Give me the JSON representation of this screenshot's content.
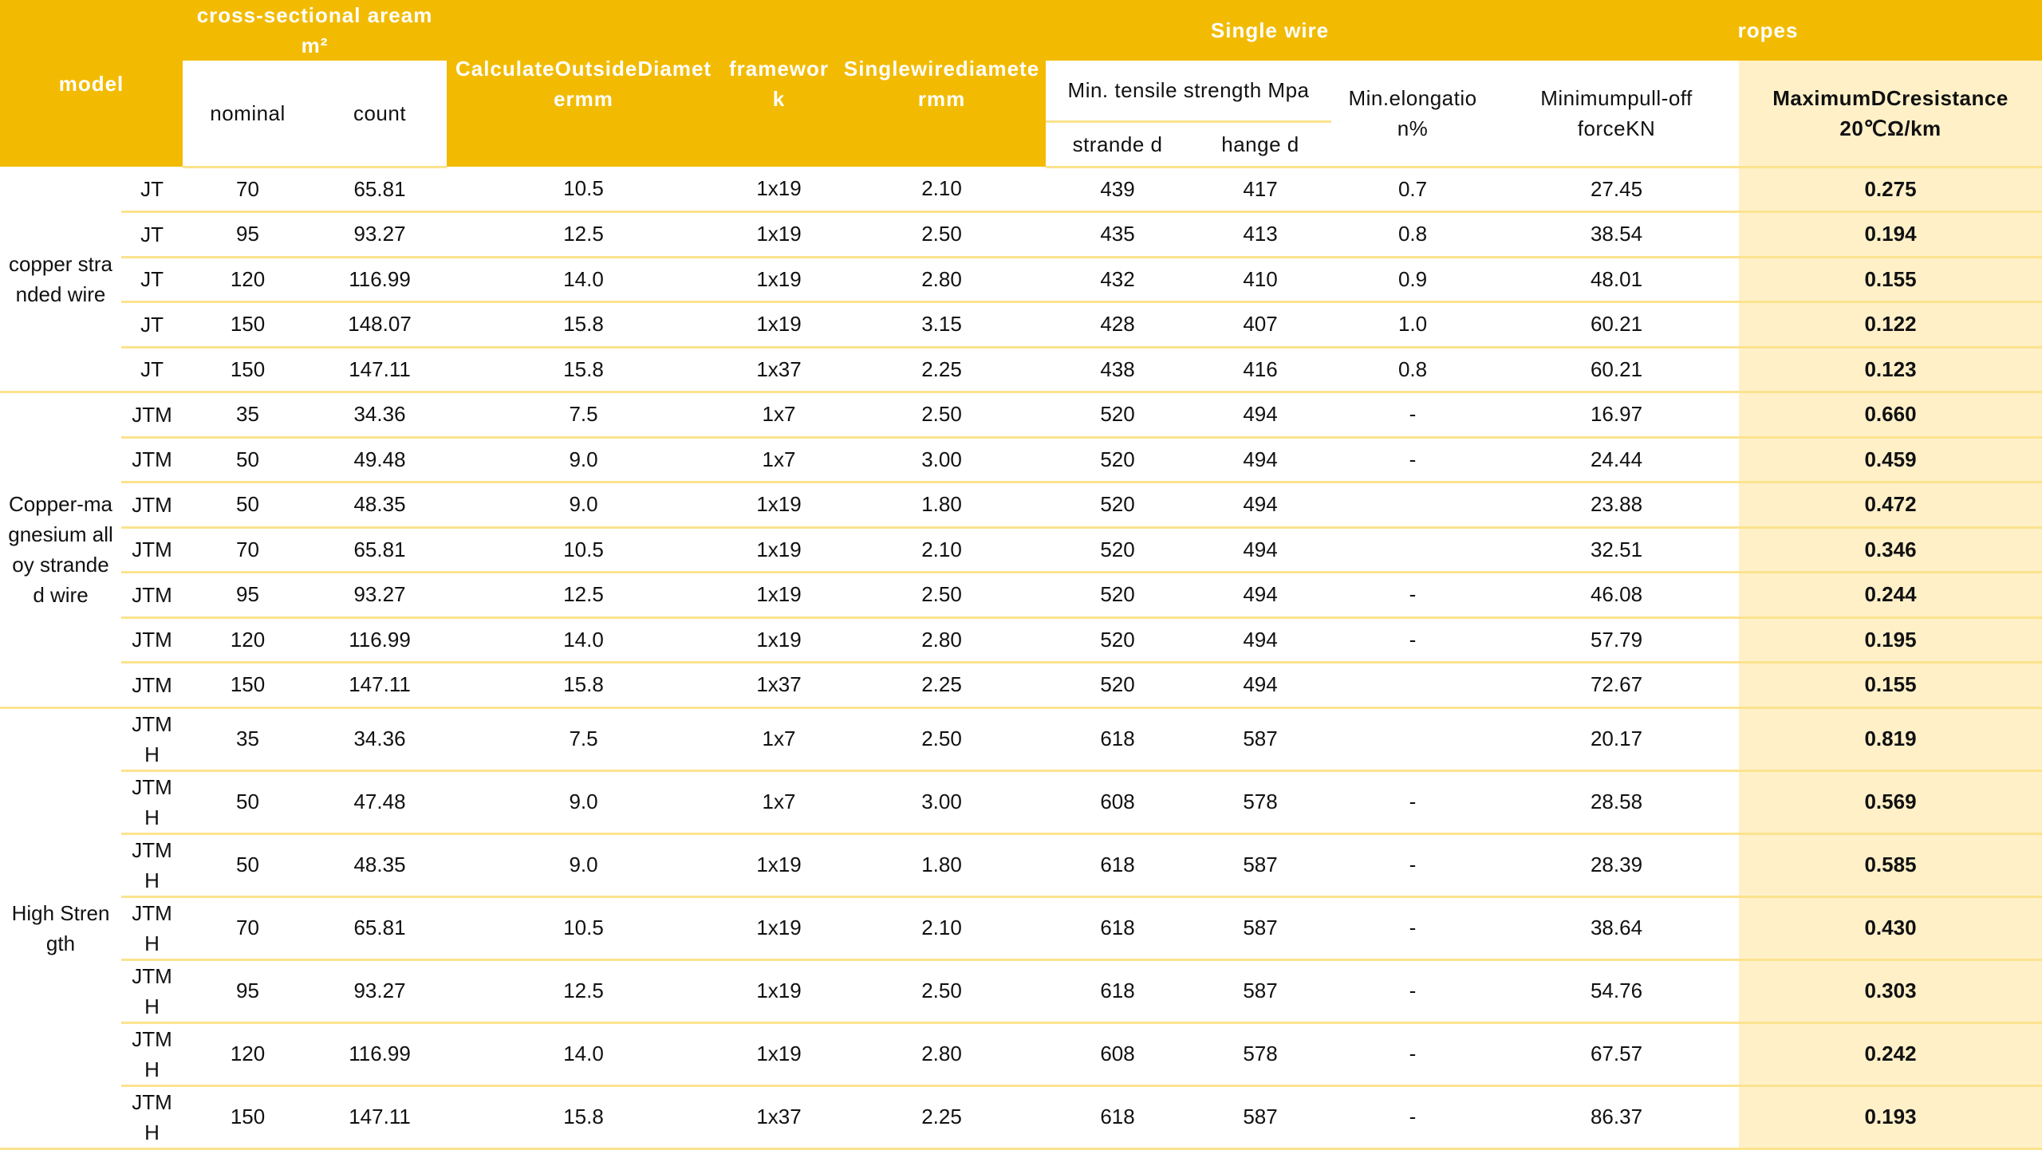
{
  "header": {
    "model": "model",
    "cross_section": "cross-sectional areamm²",
    "nominal": "nominal",
    "count": "count",
    "outside_diameter": "CalculateOutsideDiametermm",
    "framework": "framework",
    "single_wire_diameter": "Singlewirediametermm",
    "single_wire": "Single wire",
    "ropes": "ropes",
    "min_tensile": "Min. tensile strength Mpa",
    "stranded": "strande d",
    "hanged": "hange d",
    "min_elongation": "Min.elongation%",
    "min_pull_off": "Minimumpull-off forceKN",
    "max_dc_resistance": "MaximumDCresistance 20℃Ω/km"
  },
  "colors": {
    "header": "#F2BB02",
    "border": "#FBE38E",
    "highlight": "#FFF0C8"
  },
  "groups": [
    {
      "label": "copper stranded wire",
      "size": "short",
      "rows": [
        [
          "JT",
          "70",
          "65.81",
          "10.5",
          "1x19",
          "2.10",
          "439",
          "417",
          "0.7",
          "27.45",
          "0.275"
        ],
        [
          "JT",
          "95",
          "93.27",
          "12.5",
          "1x19",
          "2.50",
          "435",
          "413",
          "0.8",
          "38.54",
          "0.194"
        ],
        [
          "JT",
          "120",
          "116.99",
          "14.0",
          "1x19",
          "2.80",
          "432",
          "410",
          "0.9",
          "48.01",
          "0.155"
        ],
        [
          "JT",
          "150",
          "148.07",
          "15.8",
          "1x19",
          "3.15",
          "428",
          "407",
          "1.0",
          "60.21",
          "0.122"
        ],
        [
          "JT",
          "150",
          "147.11",
          "15.8",
          "1x37",
          "2.25",
          "438",
          "416",
          "0.8",
          "60.21",
          "0.123"
        ]
      ]
    },
    {
      "label": "Copper-magnesium alloy stranded wire",
      "size": "short",
      "rows": [
        [
          "JTM",
          "35",
          "34.36",
          "7.5",
          "1x7",
          "2.50",
          "520",
          "494",
          "-",
          "16.97",
          "0.660"
        ],
        [
          "JTM",
          "50",
          "49.48",
          "9.0",
          "1x7",
          "3.00",
          "520",
          "494",
          "-",
          "24.44",
          "0.459"
        ],
        [
          "JTM",
          "50",
          "48.35",
          "9.0",
          "1x19",
          "1.80",
          "520",
          "494",
          "",
          "23.88",
          "0.472"
        ],
        [
          "JTM",
          "70",
          "65.81",
          "10.5",
          "1x19",
          "2.10",
          "520",
          "494",
          "",
          "32.51",
          "0.346"
        ],
        [
          "JTM",
          "95",
          "93.27",
          "12.5",
          "1x19",
          "2.50",
          "520",
          "494",
          "-",
          "46.08",
          "0.244"
        ],
        [
          "JTM",
          "120",
          "116.99",
          "14.0",
          "1x19",
          "2.80",
          "520",
          "494",
          "-",
          "57.79",
          "0.195"
        ],
        [
          "JTM",
          "150",
          "147.11",
          "15.8",
          "1x37",
          "2.25",
          "520",
          "494",
          "",
          "72.67",
          "0.155"
        ]
      ]
    },
    {
      "label": "High Strength",
      "size": "tall",
      "rows": [
        [
          "JTMH",
          "35",
          "34.36",
          "7.5",
          "1x7",
          "2.50",
          "618",
          "587",
          "",
          "20.17",
          "0.819"
        ],
        [
          "JTMH",
          "50",
          "47.48",
          "9.0",
          "1x7",
          "3.00",
          "608",
          "578",
          "-",
          "28.58",
          "0.569"
        ],
        [
          "JTMH",
          "50",
          "48.35",
          "9.0",
          "1x19",
          "1.80",
          "618",
          "587",
          "-",
          "28.39",
          "0.585"
        ],
        [
          "JTMH",
          "70",
          "65.81",
          "10.5",
          "1x19",
          "2.10",
          "618",
          "587",
          "-",
          "38.64",
          "0.430"
        ],
        [
          "JTMH",
          "95",
          "93.27",
          "12.5",
          "1x19",
          "2.50",
          "618",
          "587",
          "-",
          "54.76",
          "0.303"
        ],
        [
          "JTMH",
          "120",
          "116.99",
          "14.0",
          "1x19",
          "2.80",
          "608",
          "578",
          "-",
          "67.57",
          "0.242"
        ],
        [
          "JTMH",
          "150",
          "147.11",
          "15.8",
          "1x37",
          "2.25",
          "618",
          "587",
          "-",
          "86.37",
          "0.193"
        ]
      ]
    }
  ]
}
